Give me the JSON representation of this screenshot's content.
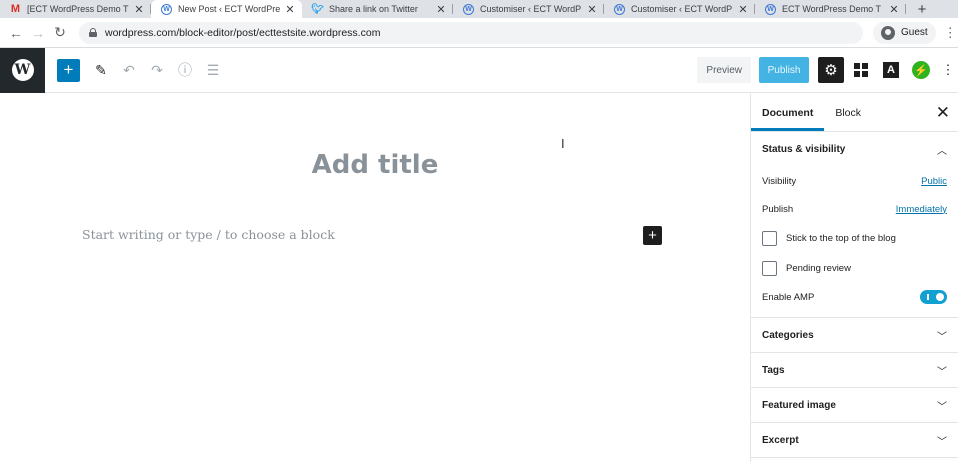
{
  "browser": {
    "tabs": [
      {
        "label": "[ECT WordPress Demo T",
        "icon": "gmail-icon",
        "active": false
      },
      {
        "label": "New Post ‹ ECT WordPre",
        "icon": "wordpress-icon",
        "active": true
      },
      {
        "label": "Share a link on Twitter",
        "icon": "twitter-icon",
        "active": false
      },
      {
        "label": "Customiser ‹ ECT WordP",
        "icon": "wordpress-icon",
        "active": false
      },
      {
        "label": "Customiser ‹ ECT WordP",
        "icon": "wordpress-icon",
        "active": false
      },
      {
        "label": "ECT WordPress Demo T",
        "icon": "wordpress-icon",
        "active": false
      }
    ],
    "url": "wordpress.com/block-editor/post/ecttestsite.wordpress.com",
    "profile_label": "Guest"
  },
  "toolbar": {
    "preview_label": "Preview",
    "publish_label": "Publish",
    "amp_label": "A"
  },
  "editor": {
    "title_placeholder": "Add title",
    "body_placeholder": "Start writing or type / to choose a block"
  },
  "sidebar": {
    "tabs": {
      "document": "Document",
      "block": "Block"
    },
    "status_visibility": {
      "heading": "Status & visibility",
      "visibility_label": "Visibility",
      "visibility_value": "Public",
      "publish_label": "Publish",
      "publish_value": "Immediately",
      "stick_label": "Stick to the top of the blog",
      "pending_label": "Pending review",
      "amp_label": "Enable AMP",
      "amp_enabled": true
    },
    "panels": {
      "categories": "Categories",
      "tags": "Tags",
      "featured_image": "Featured image",
      "excerpt": "Excerpt"
    }
  },
  "colors": {
    "wp_blue": "#007cba",
    "publish_blue": "#23a6e0",
    "jetpack_green": "#2fb41f",
    "toggle_on": "#11a0d2"
  }
}
